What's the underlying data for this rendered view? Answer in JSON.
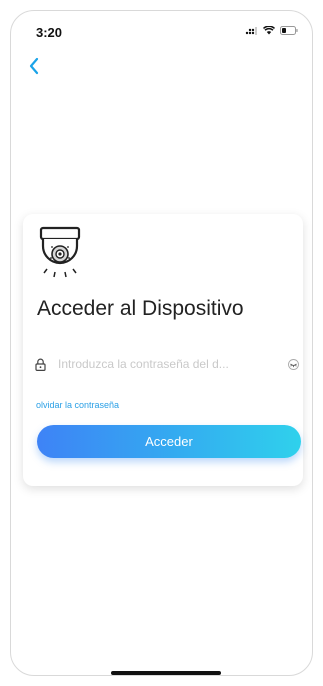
{
  "status_bar": {
    "time": "3:20",
    "icons": [
      "signal-icon",
      "wifi-icon",
      "battery-icon"
    ]
  },
  "nav": {
    "back_icon": "chevron-left-icon",
    "accent_color": "#1aa3e8"
  },
  "card": {
    "device_icon": "dome-camera-icon",
    "title": "Acceder al Dispositivo",
    "password": {
      "lock_icon": "lock-icon",
      "placeholder": "Introduzca la contraseña del d...",
      "value": "",
      "toggle_icon": "eye-closed-icon"
    },
    "forgot_label": "olvidar la contraseña",
    "login_label": "Acceder",
    "button_gradient": [
      "#3e83f6",
      "#2fd1ec"
    ]
  }
}
